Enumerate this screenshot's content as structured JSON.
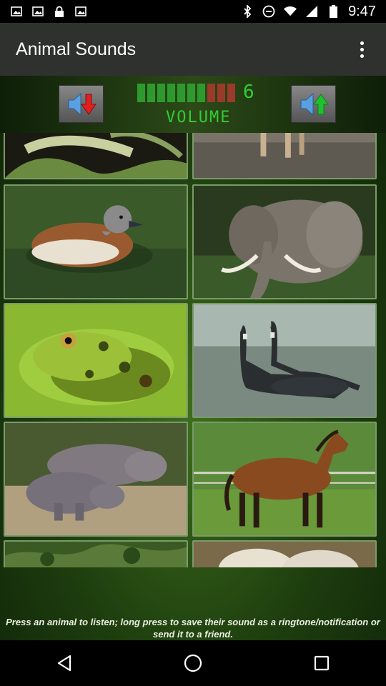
{
  "status_bar": {
    "time": "9:47",
    "left_icons": [
      "image-icon",
      "image-icon",
      "lock-icon",
      "image-icon"
    ],
    "right_icons": [
      "bluetooth-icon",
      "minus-circle-icon",
      "wifi-icon",
      "signal-icon",
      "battery-icon"
    ]
  },
  "app_bar": {
    "title": "Animal Sounds",
    "menu_icon": "overflow-menu-icon"
  },
  "volume": {
    "level": "6",
    "label": "VOLUME",
    "down_icon": "volume-down-icon",
    "up_icon": "volume-up-icon",
    "segments_total": 10,
    "segments_green": 7
  },
  "animals": [
    {
      "name": "snake",
      "row": "partial-top"
    },
    {
      "name": "animal legs",
      "row": "partial-top"
    },
    {
      "name": "duck"
    },
    {
      "name": "elephant"
    },
    {
      "name": "frog"
    },
    {
      "name": "geese"
    },
    {
      "name": "hippopotamus"
    },
    {
      "name": "horse"
    },
    {
      "name": "forest animal",
      "row": "partial-bottom"
    },
    {
      "name": "sheep",
      "row": "partial-bottom"
    }
  ],
  "footer": {
    "hint": "Press an animal to listen; long press to save their sound as a ringtone/notification or send it to a friend."
  },
  "nav": {
    "back_icon": "back-triangle-icon",
    "home_icon": "home-circle-icon",
    "recents_icon": "recents-square-icon"
  },
  "colors": {
    "app_bar": "#2f312f",
    "volume_green": "#33cc33",
    "background_green": "#3e6e1d"
  }
}
